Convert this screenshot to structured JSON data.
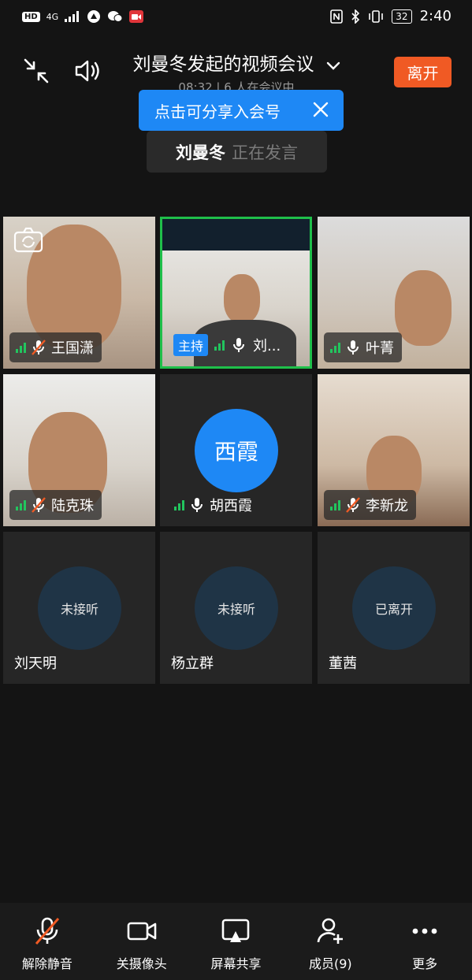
{
  "status_bar": {
    "left_items": [
      "HD",
      "4G"
    ],
    "battery": "32",
    "time": "2:40"
  },
  "meeting": {
    "title": "刘曼冬发起的视频会议",
    "subtitle": "08:32 | 6 人在会议中",
    "leave_label": "离开",
    "tooltip": "点击可分享入会号",
    "speaker_name": "刘曼冬",
    "speaker_state": "正在发言"
  },
  "participants": [
    {
      "name": "王国潇",
      "mic": "muted",
      "type": "video"
    },
    {
      "name": "刘...",
      "mic": "on",
      "type": "video",
      "host_tag": "主持"
    },
    {
      "name": "叶菁",
      "mic": "on",
      "type": "video"
    },
    {
      "name": "陆克珠",
      "mic": "muted",
      "type": "video"
    },
    {
      "name": "胡西霞",
      "mic": "on",
      "type": "avatar",
      "avatar_text": "西霞"
    },
    {
      "name": "李新龙",
      "mic": "muted",
      "type": "video"
    },
    {
      "name": "刘天明",
      "type": "pending",
      "status": "未接听"
    },
    {
      "name": "杨立群",
      "type": "pending",
      "status": "未接听"
    },
    {
      "name": "董茜",
      "type": "pending",
      "status": "已离开"
    }
  ],
  "toolbar": {
    "unmute": "解除静音",
    "camera_off": "关摄像头",
    "screen_share": "屏幕共享",
    "members": "成员(9)",
    "more": "更多"
  },
  "colors": {
    "accent": "#1e88f5",
    "leave": "#f05a24",
    "signal": "#22c55e",
    "host_border": "#1fbf4a"
  }
}
